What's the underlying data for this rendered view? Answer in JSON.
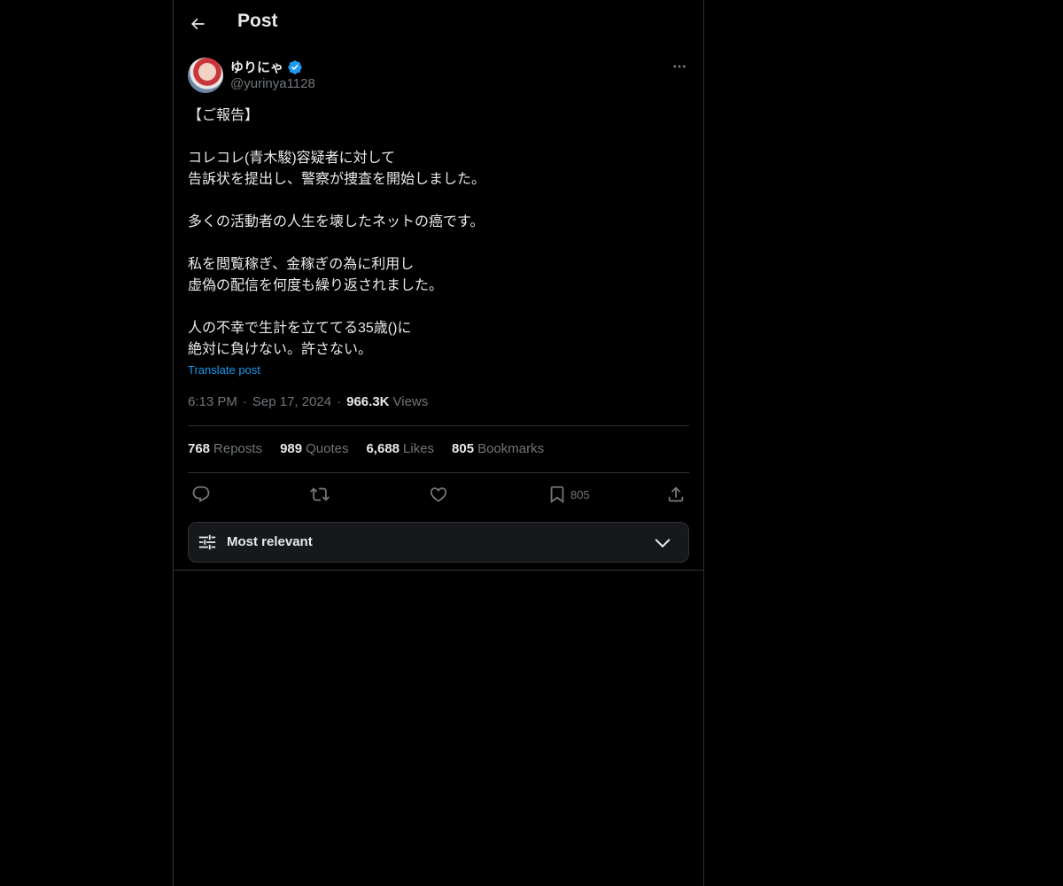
{
  "header": {
    "title": "Post",
    "back_icon": "arrow-left-icon"
  },
  "post": {
    "author": {
      "display_name": "ゆりにゃ",
      "handle": "@yurinya1128",
      "verified": true
    },
    "text": "【ご報告】\n\nコレコレ(青木駿)容疑者に対して\n告訴状を提出し、警察が捜査を開始しました。\n\n多くの活動者の人生を壊したネットの癌です。\n\n私を閲覧稼ぎ、金稼ぎの為に利用し\n虚偽の配信を何度も繰り返されました。\n\n人の不幸で生計を立ててる35歳()に\n絶対に負けない。許さない。",
    "translate_label": "Translate post",
    "time": "6:13 PM",
    "date": "Sep 17, 2024",
    "views_count": "966.3K",
    "views_label": "Views",
    "stats": {
      "reposts": {
        "count": "768",
        "label": "Reposts"
      },
      "quotes": {
        "count": "989",
        "label": "Quotes"
      },
      "likes": {
        "count": "6,688",
        "label": "Likes"
      },
      "bookmarks": {
        "count": "805",
        "label": "Bookmarks"
      }
    },
    "actions": {
      "bookmark_count": "805"
    }
  },
  "sort": {
    "label": "Most relevant"
  },
  "colors": {
    "background": "#000000",
    "text_primary": "#e7e9ea",
    "text_secondary": "#71767b",
    "accent": "#1d9bf0",
    "border": "#2f3336"
  }
}
